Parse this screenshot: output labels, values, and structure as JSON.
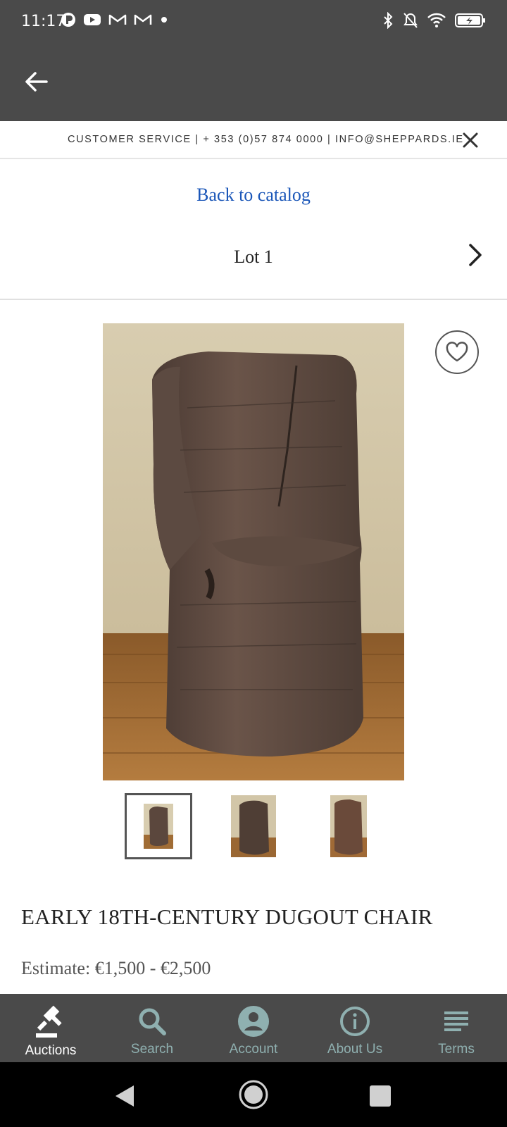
{
  "status_bar": {
    "time": "11:17",
    "left_icons": [
      "app-icon",
      "youtube-icon",
      "gmail-icon",
      "gmail-icon",
      "dot-icon"
    ],
    "right_icons": [
      "bluetooth-icon",
      "mute-icon",
      "wifi-icon",
      "battery-charging-icon"
    ]
  },
  "app_bar": {
    "back_icon": "arrow-left-icon"
  },
  "customer_service": {
    "text": "CUSTOMER SERVICE | + 353 (0)57 874 0000 | INFO@SHEPPARDS.IE",
    "close_icon": "close-icon"
  },
  "catalog": {
    "back_link": "Back to catalog",
    "lot_label": "Lot 1",
    "next_icon": "chevron-right-icon"
  },
  "lot": {
    "title": "EARLY 18TH-CENTURY DUGOUT CHAIR",
    "estimate": "Estimate: €1,500 - €2,500",
    "favorite_icon": "heart-outline-icon",
    "thumbnails_count_selected_index": 0
  },
  "bottom_nav": {
    "items": [
      {
        "label": "Auctions",
        "icon": "gavel-icon",
        "active": true
      },
      {
        "label": "Search",
        "icon": "search-icon",
        "active": false
      },
      {
        "label": "Account",
        "icon": "account-circle-icon",
        "active": false
      },
      {
        "label": "About Us",
        "icon": "info-icon",
        "active": false
      },
      {
        "label": "Terms",
        "icon": "lines-icon",
        "active": false
      }
    ]
  },
  "colors": {
    "app_bar": "#4a4a4a",
    "link": "#1a56b8",
    "nav_inactive": "#8fb0b0",
    "nav_active": "#ffffff"
  }
}
